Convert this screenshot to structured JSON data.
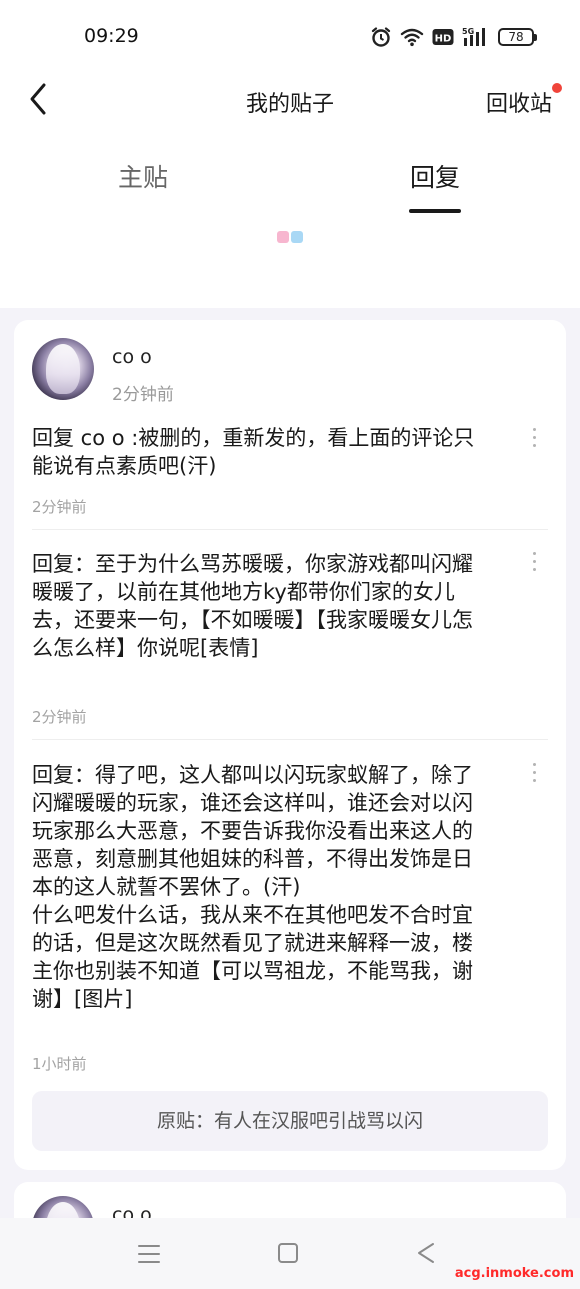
{
  "status_bar": {
    "time": "09:29",
    "network": "5G",
    "hd": "HD",
    "battery": "78",
    "icons": [
      "alarm-icon",
      "wifi-icon",
      "hd-icon",
      "signal-icon",
      "battery-icon"
    ]
  },
  "header": {
    "back_icon": "chevron-left-icon",
    "title": "我的贴子",
    "recycle_label": "回收站",
    "recycle_has_badge": true
  },
  "tabs": [
    {
      "label": "主贴",
      "active": false
    },
    {
      "label": "回复",
      "active": true
    }
  ],
  "card": {
    "user": {
      "name": "co o",
      "time": "2分钟前"
    },
    "replies": [
      {
        "text": "回复 co o :被删的，重新发的，看上面的评论只能说有点素质吧(汗)",
        "time": "2分钟前"
      },
      {
        "text": "回复：至于为什么骂苏暖暖，你家游戏都叫闪耀暖暖了，以前在其他地方ky都带你们家的女儿去，还要来一句，【不如暖暖】【我家暖暖女儿怎么怎么样】你说呢[表情]",
        "time": "2分钟前"
      },
      {
        "text": "回复：得了吧，这人都叫以闪玩家蚁解了，除了闪耀暖暖的玩家，谁还会这样叫，谁还会对以闪玩家那么大恶意，不要告诉我你没看出来这人的恶意，刻意删其他姐妹的科普，不得出发饰是日本的这人就誓不罢休了。(汗)\n 什么吧发什么话，我从来不在其他吧发不合时宜的话，但是这次既然看见了就进来解释一波，楼主你也别装不知道【可以骂祖龙，不能骂我，谢谢】[图片]",
        "time": "1小时前"
      }
    ],
    "original_post": "原贴：有人在汉服吧引战骂以闪"
  },
  "card2": {
    "user": {
      "name": "co o"
    }
  },
  "nav": {
    "icons": [
      "menu-icon",
      "home-icon",
      "back-triangle-icon"
    ]
  },
  "watermark": "acg.inmoke.com",
  "colors": {
    "badge": "#f0443a",
    "loading_pink": "#f7b6cf",
    "loading_blue": "#a9d8f5",
    "watermark": "#ff2a2a"
  }
}
